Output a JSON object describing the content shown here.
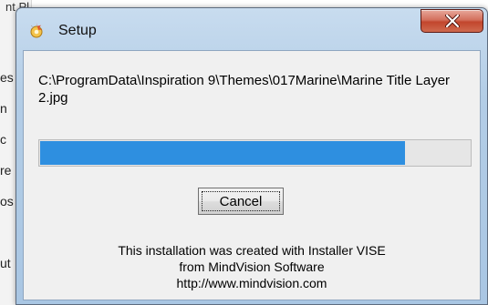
{
  "background": {
    "title_fragment": "nt Pl",
    "side_fragments": [
      "es",
      "n",
      "c",
      "re",
      "os",
      "ut"
    ]
  },
  "dialog": {
    "title": "Setup",
    "icon": "setup-icon",
    "close_icon": "close-icon",
    "path_text": "C:\\ProgramData\\Inspiration 9\\Themes\\017Marine\\Marine Title Layer 2.jpg",
    "progress_fraction": 0.85,
    "progress_color": "#2e8fe0",
    "cancel_label": "Cancel",
    "info_lines": [
      "This installation was created with Installer VISE",
      "from MindVision Software",
      "http://www.mindvision.com"
    ]
  }
}
